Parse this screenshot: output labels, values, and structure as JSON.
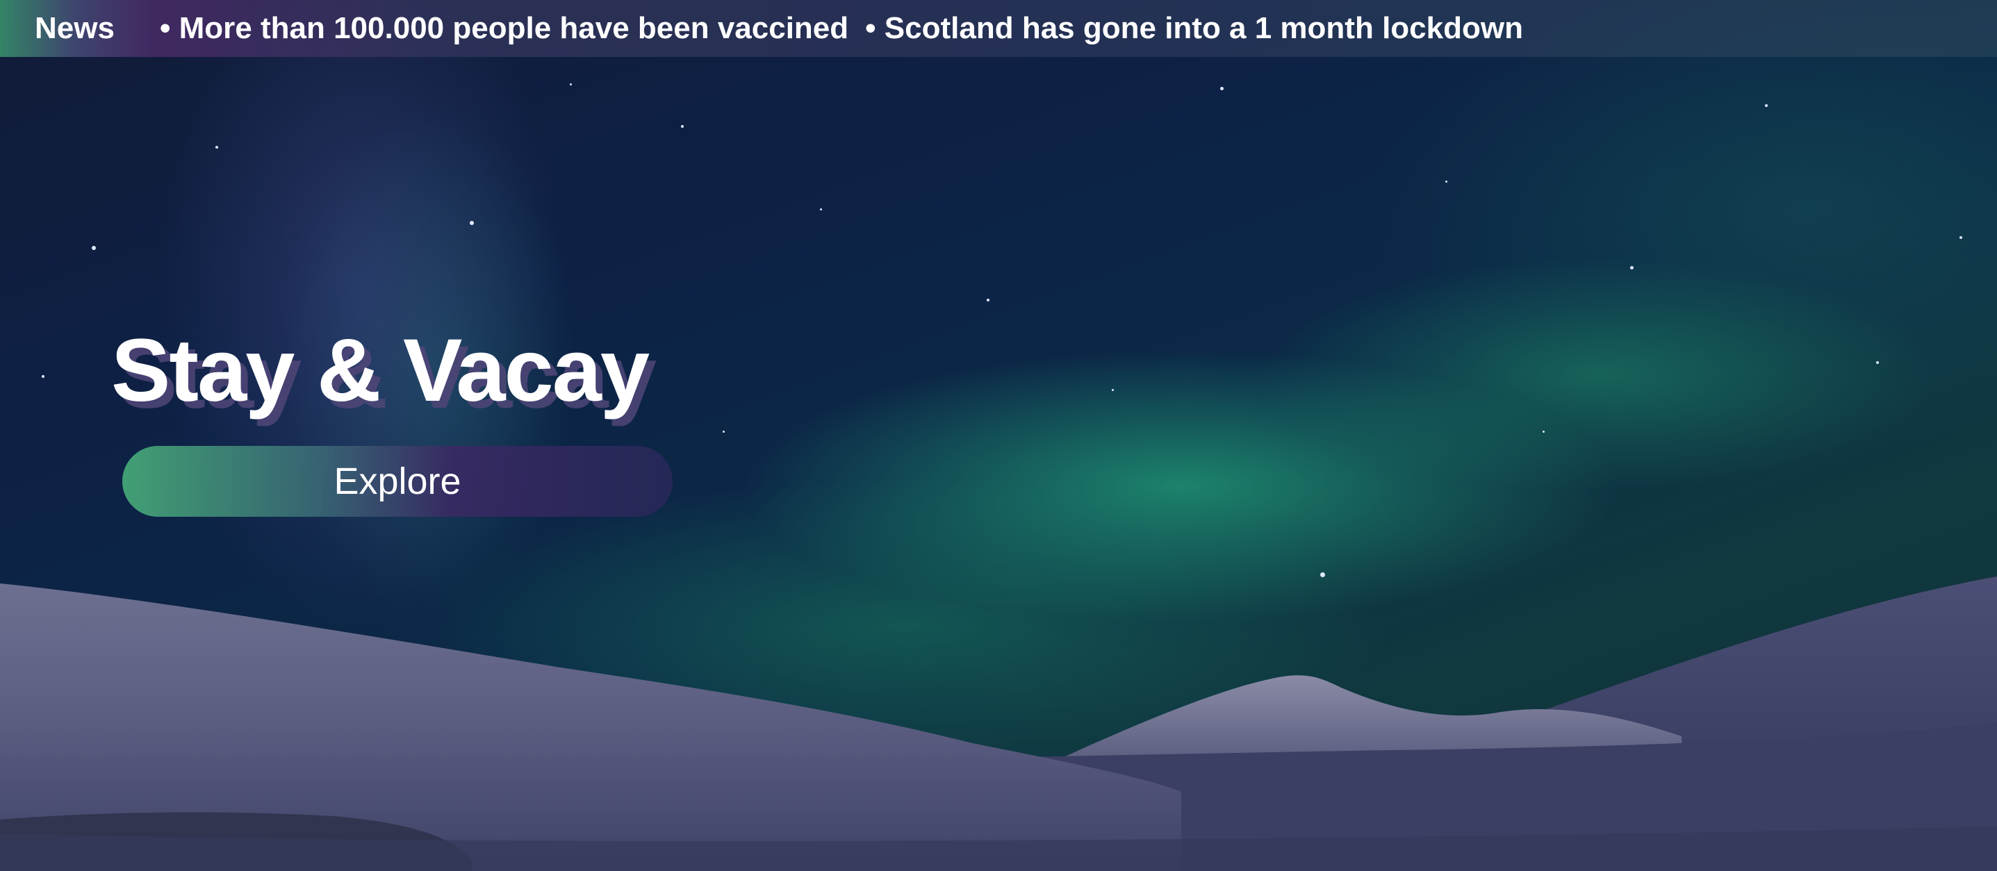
{
  "news_bar": {
    "label": "News",
    "items": [
      "More than 100.000 people have been vaccined",
      "Scotland has gone into a 1 month lockdown"
    ]
  },
  "hero": {
    "title": "Stay & Vacay",
    "button_label": "Explore"
  },
  "colors": {
    "aurora_green": "#1f8f6c",
    "sky_navy": "#0d2145",
    "title_shadow": "#504678",
    "button_green": "#46aa78",
    "button_purple": "#3c2864"
  }
}
